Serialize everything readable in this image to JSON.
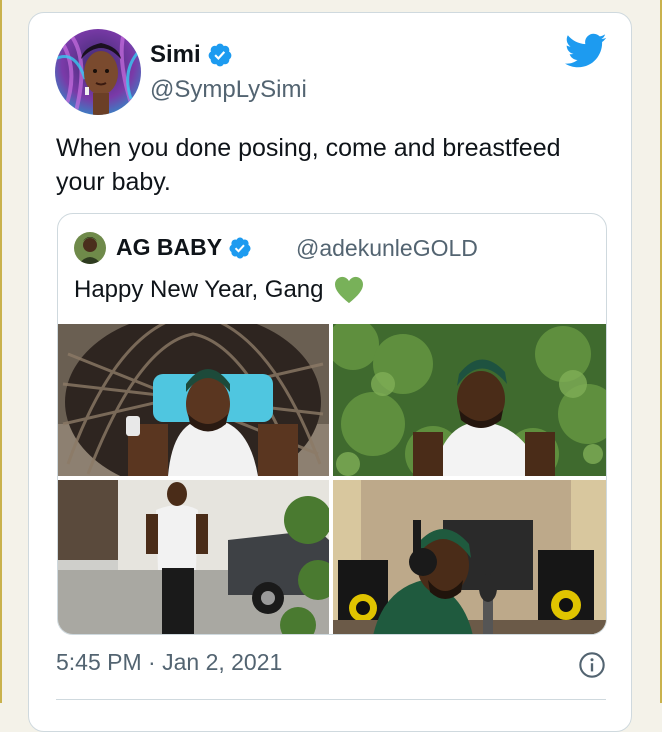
{
  "tweet": {
    "author": {
      "name": "Simi",
      "handle": "@SympLySimi",
      "verified": true
    },
    "text": "When you done posing, come and breastfeed your baby.",
    "timestamp": "5:45 PM · Jan 2, 2021",
    "quoted": {
      "author": {
        "name": "AG BABY",
        "handle": "@adekunleGOLD",
        "verified": true
      },
      "text": "Happy New Year, Gang",
      "emoji": "green-heart-icon",
      "media_count": 4
    }
  },
  "colors": {
    "brand": "#1d9bf0",
    "text": "#0f1419",
    "secondary": "#536471",
    "border": "#cfd9de"
  }
}
